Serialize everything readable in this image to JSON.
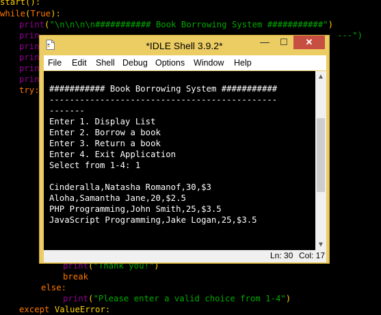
{
  "editor": {
    "line0": {
      "a": "start():"
    },
    "line1": {
      "kw": "while",
      "a": "(",
      "kw2": "True",
      "b": "):"
    },
    "line2": {
      "bi": "print",
      "a": "(",
      "st": "\"\\n\\n\\n\\n########### Book Borrowing System ###########\"",
      "b": ")"
    },
    "line3": {
      "bi": "prin",
      "st": "---\")"
    },
    "line4": {
      "bi": "prin"
    },
    "line5": {
      "bi": "prin"
    },
    "line6": {
      "bi": "prin"
    },
    "line7": {
      "bi": "prin"
    },
    "line8": {
      "kw": "try:"
    },
    "line9": {
      "bi": "print",
      "a": "(",
      "st": "\"Thank you!\"",
      "b": ")"
    },
    "line10": {
      "kw": "break"
    },
    "line11": {
      "kw": "else:"
    },
    "line12": {
      "bi": "print",
      "a": "(",
      "st": "\"Please enter a valid choice from 1-4\"",
      "b": ")"
    },
    "line13": {
      "kw": "except",
      "a": " ValueError:"
    }
  },
  "window": {
    "title": "*IDLE Shell 3.9.2*",
    "minimize": "—",
    "maximize": "☐",
    "close": "✕",
    "menu": [
      "File",
      "Edit",
      "Shell",
      "Debug",
      "Options",
      "Window",
      "Help"
    ],
    "output": [
      "########### Book Borrowing System ###########",
      "---------------------------------------------",
      "-------",
      "Enter 1. Display List",
      "Enter 2. Borrow a book",
      "Enter 3. Return a book",
      "Enter 4. Exit Application",
      "Select from 1-4: 1",
      "",
      "Cinderalla,Natasha Romanof,30,$3",
      "Aloha,Samantha Jane,20,$2.5",
      "PHP Programming,John Smith,25,$3.5",
      "JavaScript Programming,Jake Logan,25,$3.5"
    ],
    "status": {
      "ln": "Ln: 30",
      "col": "Col: 17"
    }
  }
}
